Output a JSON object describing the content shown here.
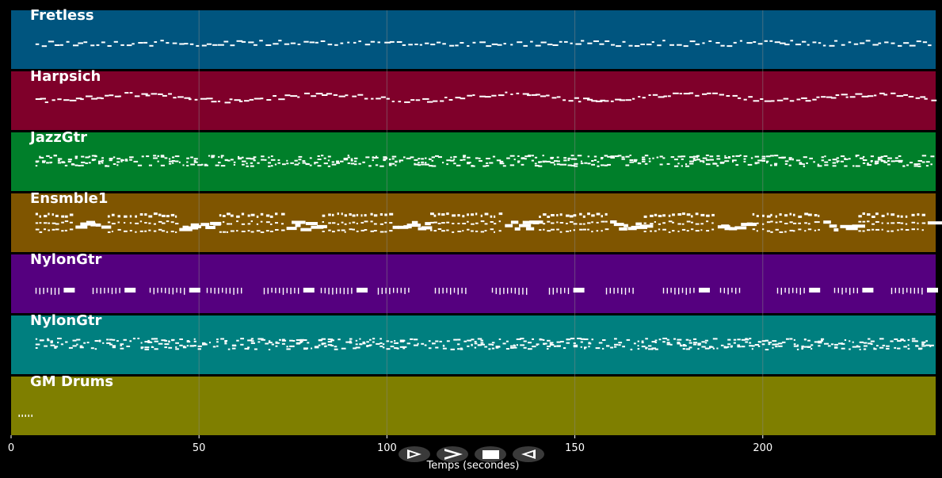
{
  "axis": {
    "xlabel": "Temps (secondes)",
    "xlim": [
      0,
      246
    ],
    "ticks": [
      0,
      50,
      100,
      150,
      200
    ],
    "tick_labels": [
      "0",
      "50",
      "100",
      "150",
      "200"
    ],
    "grid": true,
    "grid_color": "#888888"
  },
  "tracks": [
    {
      "name": "Fretless",
      "color": "#00557f",
      "pattern": "sparse-line",
      "start": 6.5,
      "end": 245
    },
    {
      "name": "Harpsich",
      "color": "#7f002a",
      "pattern": "melody",
      "start": 6.5,
      "end": 245
    },
    {
      "name": "JazzGtr",
      "color": "#007f2a",
      "pattern": "chords",
      "start": 6.5,
      "end": 245
    },
    {
      "name": "Ensmble1",
      "color": "#7f5500",
      "pattern": "ensemble",
      "start": 6.5,
      "end": 245
    },
    {
      "name": "NylonGtr",
      "color": "#55007f",
      "pattern": "plucks",
      "start": 6.5,
      "end": 245
    },
    {
      "name": "NylonGtr",
      "color": "#007f7f",
      "pattern": "chords",
      "start": 6.5,
      "end": 245
    },
    {
      "name": "GM Drums",
      "color": "#7f7f00",
      "pattern": "drums",
      "start": 2,
      "end": 6
    }
  ],
  "toolbar": [
    {
      "name": "play-button",
      "icon": "play-icon"
    },
    {
      "name": "fast-forward-button",
      "icon": "fast-forward-icon"
    },
    {
      "name": "stop-button",
      "icon": "stop-icon"
    },
    {
      "name": "rewind-button",
      "icon": "rewind-icon"
    }
  ]
}
